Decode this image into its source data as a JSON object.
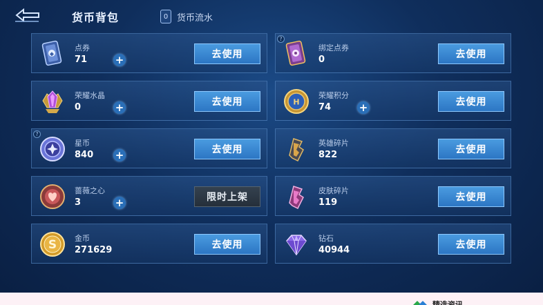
{
  "header": {
    "title": "货币背包",
    "flow_tab": "货币流水",
    "flow_icon_glyph": "0"
  },
  "cards": [
    {
      "name": "点券",
      "value": "71",
      "button": "去使用",
      "icon": "voucher-icon",
      "has_plus": true
    },
    {
      "name": "绑定点券",
      "value": "0",
      "button": "去使用",
      "icon": "bound-voucher-icon",
      "has_plus": false
    },
    {
      "name": "荣耀水晶",
      "value": "0",
      "button": "去使用",
      "icon": "glory-crystal-icon",
      "has_plus": true
    },
    {
      "name": "荣耀积分",
      "value": "74",
      "button": "去使用",
      "icon": "glory-points-icon",
      "has_plus": true
    },
    {
      "name": "星币",
      "value": "840",
      "button": "去使用",
      "icon": "star-coin-icon",
      "has_plus": true
    },
    {
      "name": "英雄碎片",
      "value": "822",
      "button": "去使用",
      "icon": "hero-shard-icon",
      "has_plus": false
    },
    {
      "name": "蔷薇之心",
      "value": "3",
      "button": "限时上架",
      "icon": "rose-heart-icon",
      "has_plus": true
    },
    {
      "name": "皮肤碎片",
      "value": "119",
      "button": "去使用",
      "icon": "skin-shard-icon",
      "has_plus": false
    },
    {
      "name": "金币",
      "value": "271629",
      "button": "去使用",
      "icon": "gold-coin-icon",
      "has_plus": false
    },
    {
      "name": "钻石",
      "value": "40944",
      "button": "去使用",
      "icon": "diamond-icon",
      "has_plus": false
    }
  ],
  "footer": {
    "text": "精选资讯"
  },
  "colors": {
    "button": "#3a88d2",
    "button_limited": "#2d3945",
    "plus": "#2a6fb8"
  }
}
